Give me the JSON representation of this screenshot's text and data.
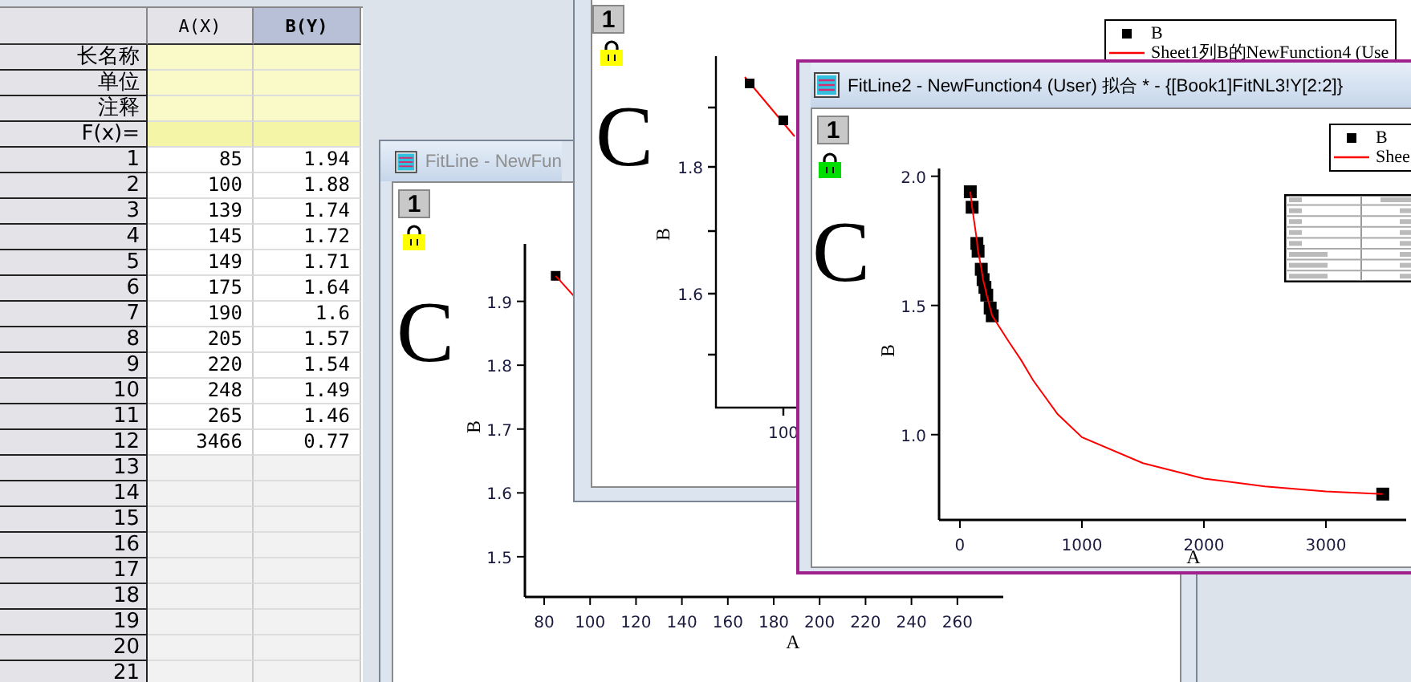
{
  "worksheet": {
    "columns": [
      {
        "label": "A(X)",
        "selected": false
      },
      {
        "label": "B(Y)",
        "selected": true
      }
    ],
    "label_rows": [
      {
        "label": "长名称",
        "kind": "label"
      },
      {
        "label": "单位",
        "kind": "label"
      },
      {
        "label": "注释",
        "kind": "label"
      },
      {
        "label": "F(x)=",
        "kind": "formula"
      }
    ],
    "rows": [
      {
        "index": "1",
        "cells": [
          "85",
          "1.94"
        ]
      },
      {
        "index": "2",
        "cells": [
          "100",
          "1.88"
        ]
      },
      {
        "index": "3",
        "cells": [
          "139",
          "1.74"
        ]
      },
      {
        "index": "4",
        "cells": [
          "145",
          "1.72"
        ]
      },
      {
        "index": "5",
        "cells": [
          "149",
          "1.71"
        ]
      },
      {
        "index": "6",
        "cells": [
          "175",
          "1.64"
        ]
      },
      {
        "index": "7",
        "cells": [
          "190",
          "1.6"
        ]
      },
      {
        "index": "8",
        "cells": [
          "205",
          "1.57"
        ]
      },
      {
        "index": "9",
        "cells": [
          "220",
          "1.54"
        ]
      },
      {
        "index": "10",
        "cells": [
          "248",
          "1.49"
        ]
      },
      {
        "index": "11",
        "cells": [
          "265",
          "1.46"
        ]
      },
      {
        "index": "12",
        "cells": [
          "3466",
          "0.77"
        ]
      },
      {
        "index": "13",
        "cells": []
      },
      {
        "index": "14",
        "cells": []
      },
      {
        "index": "15",
        "cells": []
      },
      {
        "index": "16",
        "cells": []
      },
      {
        "index": "17",
        "cells": []
      },
      {
        "index": "18",
        "cells": []
      },
      {
        "index": "19",
        "cells": []
      },
      {
        "index": "20",
        "cells": []
      },
      {
        "index": "21",
        "cells": []
      }
    ]
  },
  "graph_windows": [
    {
      "title": "FitLine - NewFun",
      "active": false,
      "layer_tab": "1",
      "lock": {
        "color": "#ffff00"
      },
      "panel_label": "C",
      "chart_data": {
        "type": "scatter",
        "xlabel": "A",
        "ylabel": "B",
        "xlim": [
          71.6,
          280
        ],
        "ylim": [
          1.437,
          1.99
        ],
        "xticks": [
          80,
          100,
          120,
          140,
          160,
          180,
          200,
          220,
          240,
          260
        ],
        "yticks": [
          1.5,
          1.6,
          1.7,
          1.8,
          1.9
        ],
        "x": [
          85,
          95
        ],
        "series": [
          {
            "type": "scatter",
            "color": "#000000",
            "values": [
              1.94,
              null
            ]
          },
          {
            "type": "line",
            "color": "#ff0000",
            "values": [
              1.94,
              1.9
            ]
          }
        ]
      }
    },
    {
      "layer_tab": "1",
      "lock": {
        "color": "#ffff00"
      },
      "panel_label": "C",
      "legend": [
        {
          "kind": "symbol",
          "label": "B"
        },
        {
          "kind": "line",
          "label": "Sheet1列B的NewFunction4 (Use"
        }
      ],
      "plot": {
        "ylabel": "B",
        "y_tick_labels": [
          "1.8",
          "1.6"
        ],
        "x_tick_labels": [
          "100"
        ]
      }
    },
    {
      "title": "FitLine2 - NewFunction4 (User) 拟合 * - {[Book1]FitNL3!Y[2:2]}",
      "active": true,
      "layer_tab": "1",
      "lock": {
        "color": "#00dd00"
      },
      "panel_label": "C",
      "legend": [
        {
          "kind": "symbol",
          "label": "B"
        },
        {
          "kind": "line",
          "label": "Shee"
        }
      ],
      "results_table": true,
      "chart_data": {
        "type": "scatter",
        "xlabel": "A",
        "ylabel": "B",
        "xlim": [
          -171,
          3658
        ],
        "ylim": [
          0.67,
          2.03
        ],
        "xticks": [
          0,
          1000,
          2000,
          3000
        ],
        "yticks": [
          {
            "value": 1,
            "label": "1.0"
          },
          1.5,
          {
            "value": 2,
            "label": "2.0"
          }
        ],
        "x": [
          85,
          100,
          139,
          145,
          149,
          175,
          190,
          205,
          220,
          248,
          265,
          400,
          500,
          600,
          800,
          1000,
          1500,
          2000,
          2500,
          3000,
          3466
        ],
        "series": [
          {
            "type": "scatter",
            "color": "#000000",
            "values": [
              1.94,
              1.88,
              1.74,
              null,
              1.71,
              1.64,
              1.6,
              1.57,
              1.54,
              1.49,
              1.46,
              null,
              null,
              null,
              null,
              null,
              null,
              null,
              null,
              null,
              0.77
            ]
          },
          {
            "type": "line",
            "color": "#ff0000",
            "values": [
              1.94,
              1.88,
              1.75,
              1.72,
              1.71,
              1.645,
              1.6,
              1.57,
              1.54,
              1.49,
              1.46,
              1.36,
              1.29,
              1.21,
              1.08,
              0.99,
              0.89,
              0.83,
              0.8,
              0.78,
              0.77
            ]
          }
        ]
      }
    }
  ]
}
